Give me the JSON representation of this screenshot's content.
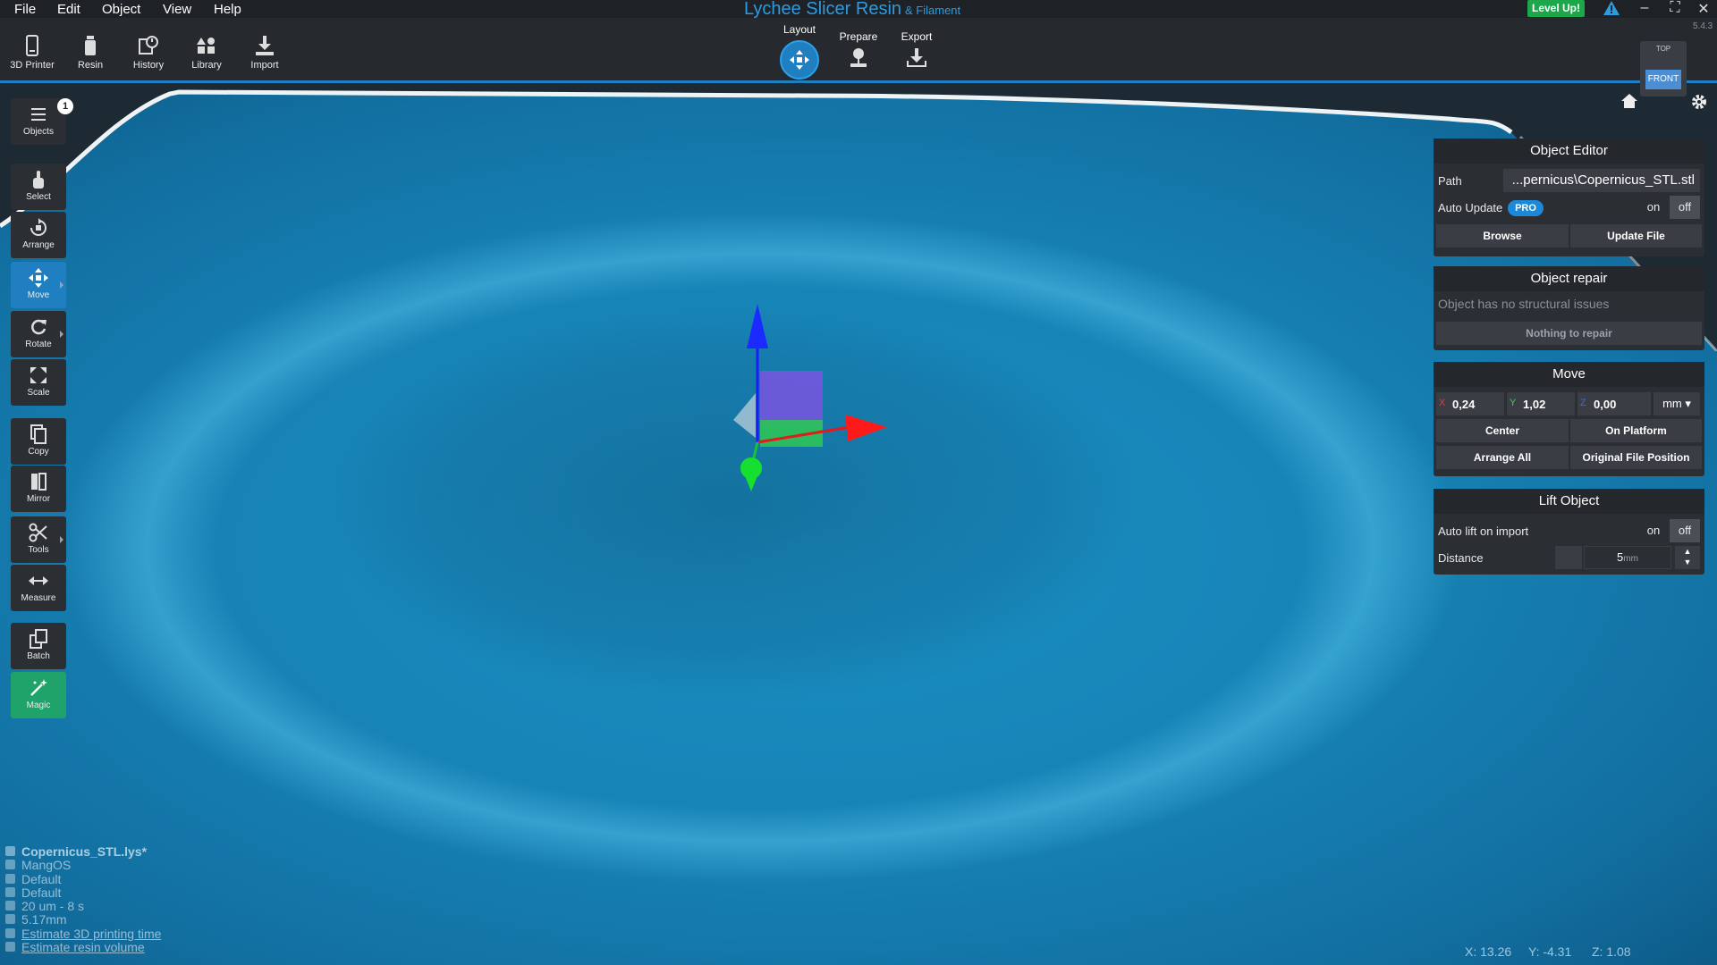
{
  "menu": [
    "File",
    "Edit",
    "Object",
    "View",
    "Help"
  ],
  "app_title": "Lychee Slicer Resin",
  "app_title_suffix": "& Filament",
  "level_up": "Level Up!",
  "version": "5.4.3",
  "toolbar": {
    "items": [
      {
        "label": "3D Printer",
        "icon": "printer-icon"
      },
      {
        "label": "Resin",
        "icon": "resin-bottle-icon"
      },
      {
        "label": "History",
        "icon": "history-icon"
      },
      {
        "label": "Library",
        "icon": "library-icon"
      },
      {
        "label": "Import",
        "icon": "import-icon"
      }
    ]
  },
  "modes": {
    "layout": "Layout",
    "prepare": "Prepare",
    "export": "Export"
  },
  "view_cube": {
    "top": "TOP",
    "front": "FRONT"
  },
  "sidebar": {
    "objects_count": "1",
    "items": [
      {
        "label": "Objects",
        "icon": "list-icon"
      },
      {
        "label": "Select",
        "icon": "hand-pointer-icon"
      },
      {
        "label": "Arrange",
        "icon": "arrange-icon"
      },
      {
        "label": "Move",
        "icon": "move-arrows-icon"
      },
      {
        "label": "Rotate",
        "icon": "rotate-icon"
      },
      {
        "label": "Scale",
        "icon": "scale-icon"
      },
      {
        "label": "Copy",
        "icon": "copy-icon"
      },
      {
        "label": "Mirror",
        "icon": "mirror-icon"
      },
      {
        "label": "Tools",
        "icon": "scissors-icon"
      },
      {
        "label": "Measure",
        "icon": "measure-icon"
      },
      {
        "label": "Batch",
        "icon": "batch-icon"
      },
      {
        "label": "Magic",
        "icon": "magic-wand-icon"
      }
    ]
  },
  "object_editor": {
    "title": "Object Editor",
    "path_label": "Path",
    "path_value": "...pernicus\\Copernicus_STL.stl",
    "auto_update_label": "Auto Update",
    "pro_badge": "PRO",
    "on": "on",
    "off": "off",
    "browse": "Browse",
    "update_file": "Update File"
  },
  "object_repair": {
    "title": "Object repair",
    "status": "Object has no structural issues",
    "button": "Nothing to repair"
  },
  "move": {
    "title": "Move",
    "x_label": "X",
    "x": "0,24",
    "y_label": "Y",
    "y": "1,02",
    "z_label": "Z",
    "z": "0,00",
    "unit": "mm",
    "center": "Center",
    "on_platform": "On Platform",
    "arrange_all": "Arrange All",
    "original_position": "Original File Position"
  },
  "lift": {
    "title": "Lift Object",
    "auto_lift_label": "Auto lift on import",
    "on": "on",
    "off": "off",
    "distance_label": "Distance",
    "distance_value": "5",
    "distance_unit": "mm"
  },
  "bottom_info": [
    "Copernicus_STL.lys*",
    "MangOS",
    "Default",
    "Default",
    "20 um - 8 s",
    "5.17mm",
    "Estimate 3D printing time",
    "Estimate resin volume"
  ],
  "cursor_coords": {
    "x": "X: 13.26",
    "y": "Y: -4.31",
    "z": "Z: 1.08"
  },
  "colors": {
    "accent": "#1f7fc0",
    "terrain": "#1783b6",
    "magic": "#1fa36a",
    "level_up": "#1ca84a"
  }
}
